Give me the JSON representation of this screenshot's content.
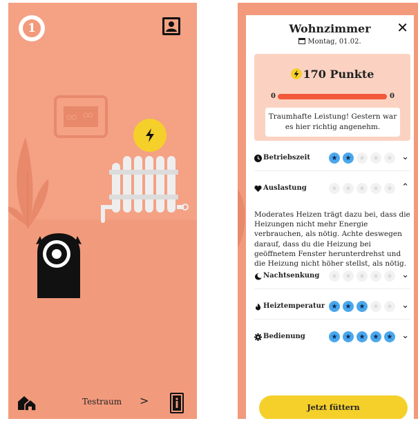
{
  "left_screen": {
    "level": "1",
    "footer": {
      "room_name": "Testraum",
      "next_arrow": ">"
    }
  },
  "right_screen": {
    "title": "Wohnzimmer",
    "close": "✕",
    "date": "Montag, 01.02.",
    "score": {
      "text": "170 Punkte",
      "bar_min": "0",
      "bar_max": "0",
      "progress": 1.0
    },
    "feedback": "Traumhafte Leistung! Gestern war es hier richtig angenehm.",
    "criteria": [
      {
        "name": "Betriebszeit",
        "icon": "clock-icon",
        "stars": 2,
        "expanded": false,
        "chevron": "⌄"
      },
      {
        "name": "Auslastung",
        "icon": "heart-icon",
        "stars": 0,
        "expanded": true,
        "chevron": "⌃"
      },
      {
        "name": "Nachtsenkung",
        "icon": "moon-icon",
        "stars": 0,
        "expanded": false,
        "chevron": "⌄"
      },
      {
        "name": "Heiztemperatur",
        "icon": "flame-icon",
        "stars": 3,
        "expanded": false,
        "chevron": "⌄"
      },
      {
        "name": "Bedienung",
        "icon": "gear-icon",
        "stars": 5,
        "expanded": false,
        "chevron": "⌄"
      }
    ],
    "explanation": "Moderates Heizen trägt dazu bei, dass die Heizungen nicht mehr Energie verbrauchen, als nötig. Achte deswegen darauf, dass du die Heizung bei geöffnetem Fenster herunterdrehst und die Heizung nicht höher stellst, als nötig.",
    "feed_button": "Jetzt füttern"
  },
  "colors": {
    "background": "#f29a7b",
    "accent_yellow": "#f5d02a",
    "star_on": "#4aa7ec",
    "bar": "#f1593a",
    "panel": "#ffffff"
  }
}
